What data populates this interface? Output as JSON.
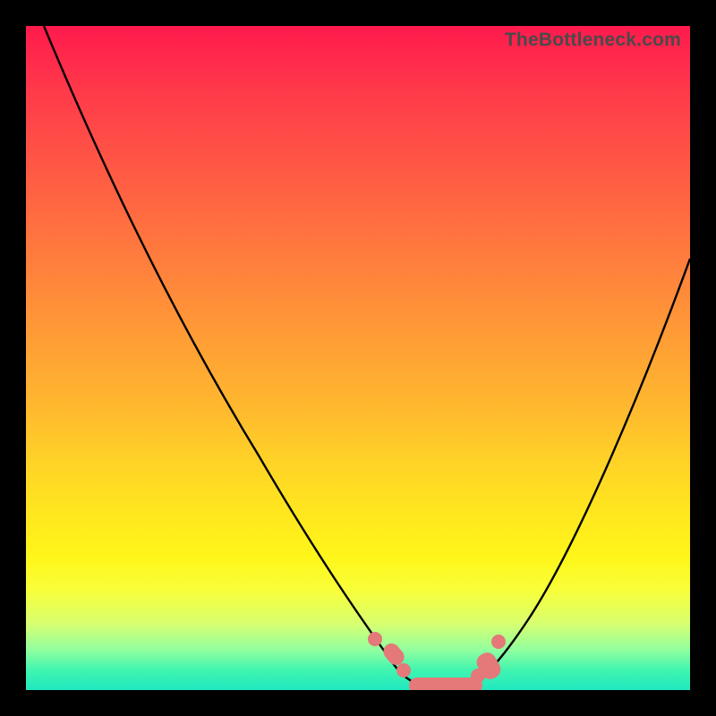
{
  "attribution": "TheBottleneck.com",
  "chart_data": {
    "type": "line",
    "title": "",
    "xlabel": "",
    "ylabel": "",
    "xlim": [
      0,
      100
    ],
    "ylim": [
      0,
      100
    ],
    "series": [
      {
        "name": "curve-left",
        "x": [
          3,
          8,
          13,
          18,
          23,
          28,
          33,
          38,
          43,
          48,
          51,
          54,
          56
        ],
        "y": [
          100,
          92,
          83,
          74,
          64,
          54,
          44,
          34,
          24,
          15,
          10,
          6,
          3
        ]
      },
      {
        "name": "curve-right",
        "x": [
          65,
          68,
          72,
          76,
          80,
          84,
          88,
          92,
          96,
          100
        ],
        "y": [
          3,
          6,
          12,
          19,
          27,
          35,
          43,
          52,
          60,
          68
        ]
      }
    ],
    "markers": {
      "color": "#e57878",
      "points": [
        {
          "x": 50,
          "y": 9
        },
        {
          "x": 52,
          "y": 6
        },
        {
          "x": 54,
          "y": 4
        },
        {
          "x": 65,
          "y": 4
        },
        {
          "x": 67,
          "y": 6
        },
        {
          "x": 68,
          "y": 9
        }
      ],
      "flat_segment": {
        "x0": 55,
        "x1": 64,
        "y": 2.5
      }
    },
    "background_gradient": {
      "top": "#ff1a4d",
      "bottom": "#20e8c0"
    }
  }
}
